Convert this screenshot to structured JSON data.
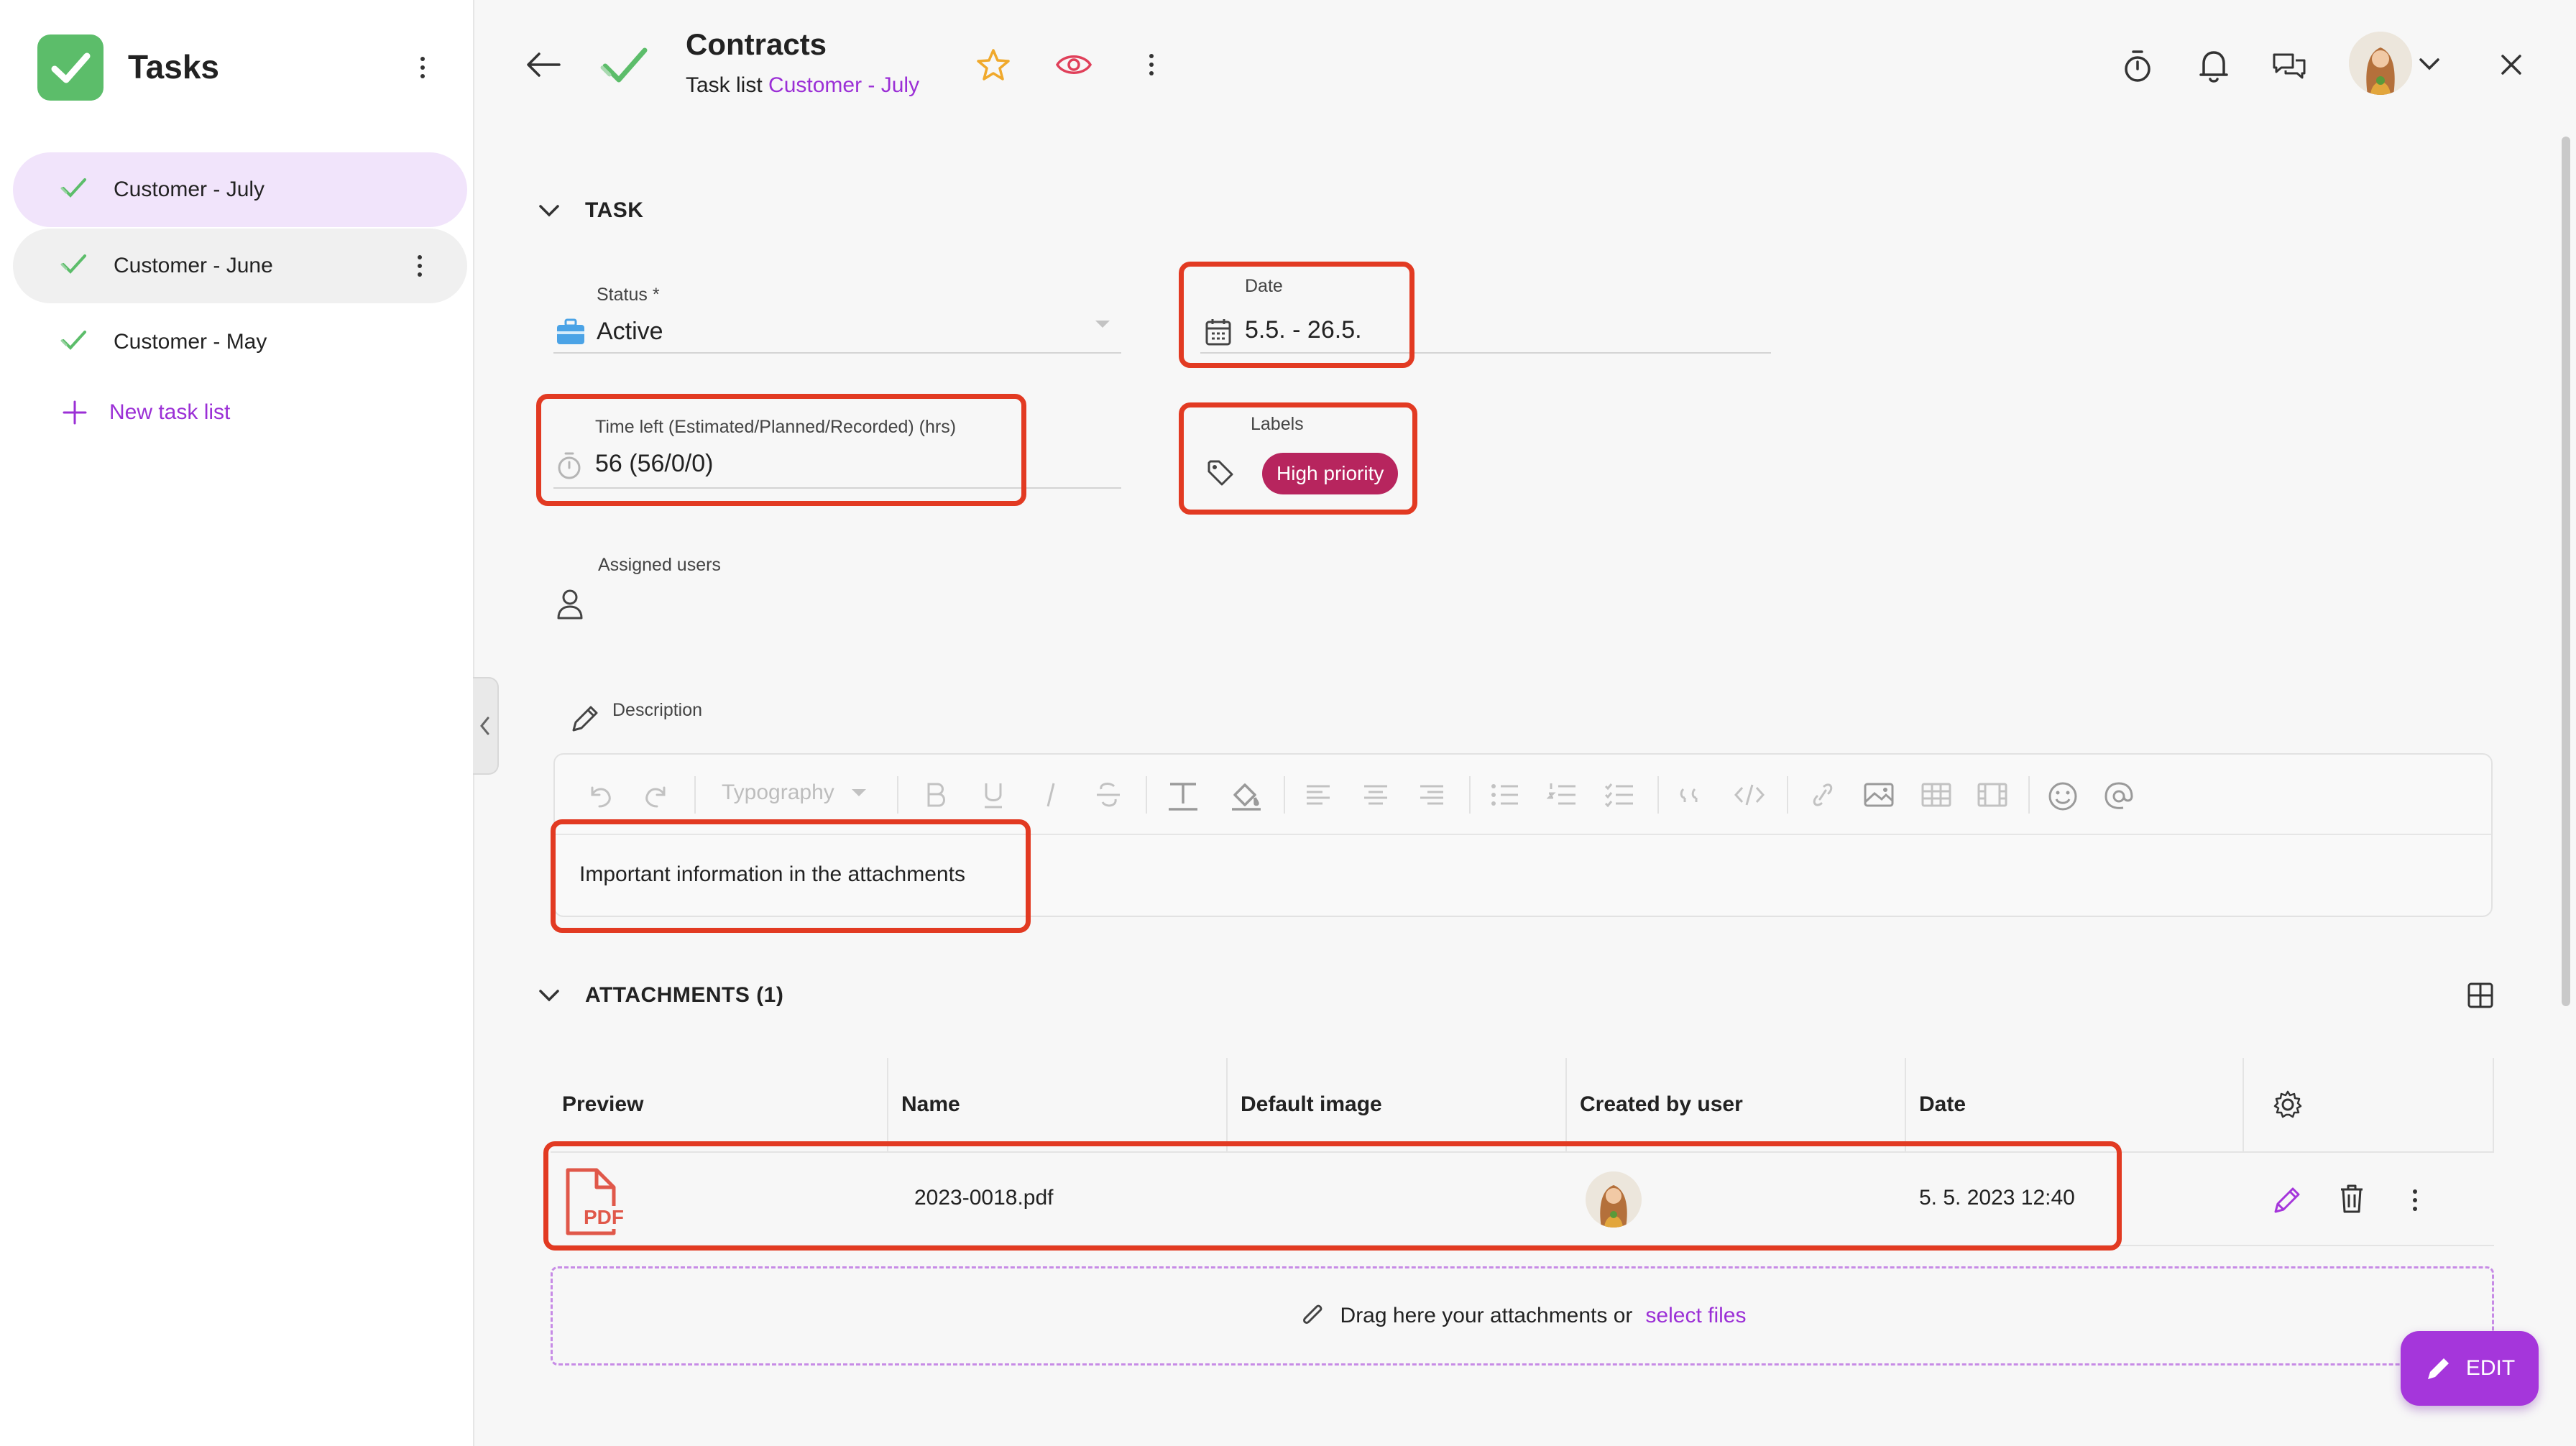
{
  "sidebar": {
    "title": "Tasks",
    "items": [
      {
        "label": "Customer - July"
      },
      {
        "label": "Customer - June"
      },
      {
        "label": "Customer - May"
      }
    ],
    "new_list_label": "New task list"
  },
  "header": {
    "title": "Contracts",
    "subtitle_prefix": "Task list",
    "subtitle_link": "Customer - July"
  },
  "task_section": {
    "heading": "TASK",
    "status": {
      "label": "Status *",
      "value": "Active"
    },
    "date": {
      "label": "Date",
      "value": "5.5. - 26.5."
    },
    "time_left": {
      "label": "Time left (Estimated/Planned/Recorded) (hrs)",
      "value": "56 (56/0/0)"
    },
    "labels": {
      "label": "Labels",
      "chips": [
        "High priority"
      ]
    },
    "assigned_users": {
      "label": "Assigned users"
    },
    "description": {
      "label": "Description",
      "text": "Important information in the attachments"
    },
    "editor_toolbar": {
      "typography_label": "Typography"
    }
  },
  "attachments": {
    "heading": "ATTACHMENTS (1)",
    "columns": [
      "Preview",
      "Name",
      "Default image",
      "Created by user",
      "Date"
    ],
    "rows": [
      {
        "preview_badge": "PDF",
        "name": "2023-0018.pdf",
        "default_image": "",
        "date": "5. 5. 2023 12:40"
      }
    ],
    "dropzone_text": "Drag here your attachments or",
    "dropzone_link": "select files"
  },
  "fab": {
    "label": "EDIT"
  },
  "colors": {
    "accent": "#9b2fd6",
    "fab": "#a536db",
    "chip": "#b7255e",
    "highlight": "#e23a22",
    "check_green": "#5cbd6a",
    "pdf_red": "#e0584a"
  },
  "icons": [
    "app-check-icon",
    "kebab-icon",
    "check-icon",
    "plus-icon",
    "back-arrow-icon",
    "star-icon",
    "eye-icon",
    "timer-icon",
    "bell-icon",
    "chat-icon",
    "chevron-down-icon",
    "close-icon",
    "briefcase-icon",
    "calendar-icon",
    "stopwatch-icon",
    "tag-icon",
    "user-icon",
    "pencil-icon",
    "grid-icon",
    "gear-icon",
    "trash-icon",
    "paperclip-icon",
    "pdf-file-icon"
  ]
}
